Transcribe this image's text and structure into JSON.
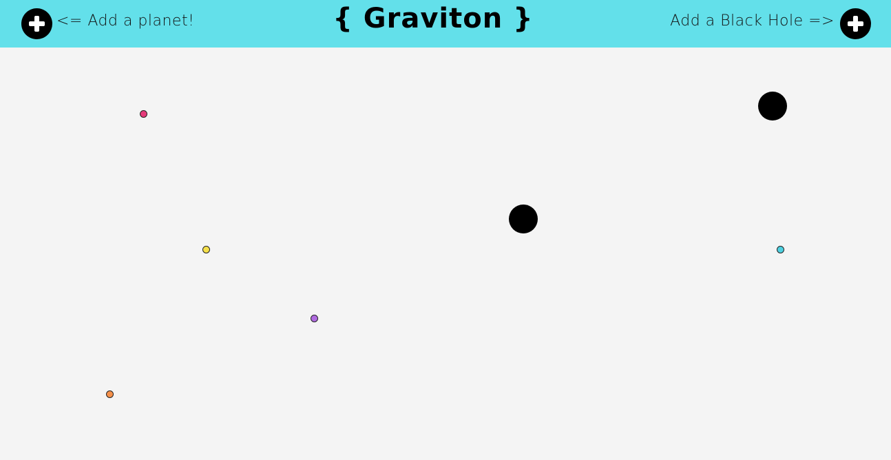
{
  "header": {
    "title": "{ Graviton }",
    "add_planet_label": "<= Add a planet!",
    "add_black_hole_label": "Add a Black Hole =>",
    "background_color": "#63e0ea"
  },
  "simulation": {
    "background_color": "#f4f4f4",
    "planets": [
      {
        "color": "#e63b7a"
      },
      {
        "color": "#f5e04a"
      },
      {
        "color": "#b06be0"
      },
      {
        "color": "#f5904a"
      },
      {
        "color": "#4ed0e0"
      }
    ],
    "black_hole_color": "#000000"
  }
}
